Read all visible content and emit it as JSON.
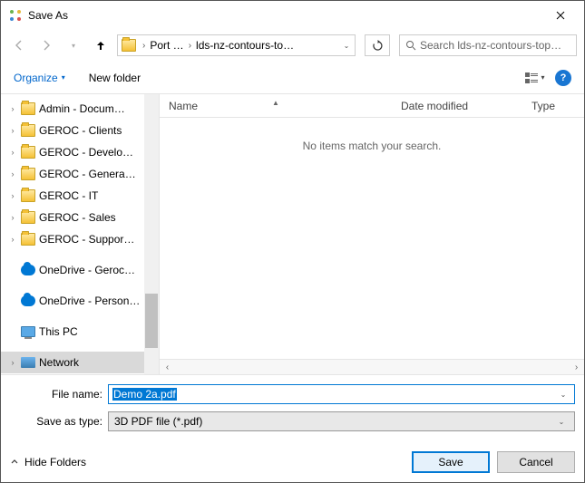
{
  "title": "Save As",
  "breadcrumb": {
    "item1": "Port …",
    "item2": "lds-nz-contours-to…"
  },
  "search": {
    "placeholder": "Search lds-nz-contours-top…"
  },
  "toolbar": {
    "organize": "Organize",
    "newfolder": "New folder"
  },
  "columns": {
    "name": "Name",
    "date": "Date modified",
    "type": "Type"
  },
  "empty": "No items match your search.",
  "tree": {
    "t0": "Admin - Docum…",
    "t1": "GEROC - Clients",
    "t2": "GEROC - Develo…",
    "t3": "GEROC - Genera…",
    "t4": "GEROC - IT",
    "t5": "GEROC - Sales",
    "t6": "GEROC - Suppor…",
    "t7": "OneDrive - Geroc…",
    "t8": "OneDrive - Person…",
    "t9": "This PC",
    "t10": "Network"
  },
  "form": {
    "filename_label": "File name:",
    "filename_value": "Demo 2a.pdf",
    "type_label": "Save as type:",
    "type_value": "3D PDF file (*.pdf)"
  },
  "footer": {
    "hide": "Hide Folders",
    "save": "Save",
    "cancel": "Cancel"
  }
}
